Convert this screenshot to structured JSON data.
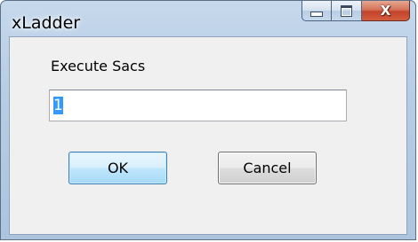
{
  "window": {
    "title": "xLadder",
    "close_glyph": "X"
  },
  "dialog": {
    "prompt": "Execute Sacs",
    "input_value": "1",
    "ok_label": "OK",
    "cancel_label": "Cancel"
  },
  "colors": {
    "title_gradient_top": "#c5d8ec",
    "client_background": "#f0f0f0",
    "close_button": "#c1442a",
    "default_button_border": "#3c7fb1",
    "selection": "#3399ff"
  },
  "icons": [
    "minimize-icon",
    "maximize-icon",
    "close-icon"
  ]
}
